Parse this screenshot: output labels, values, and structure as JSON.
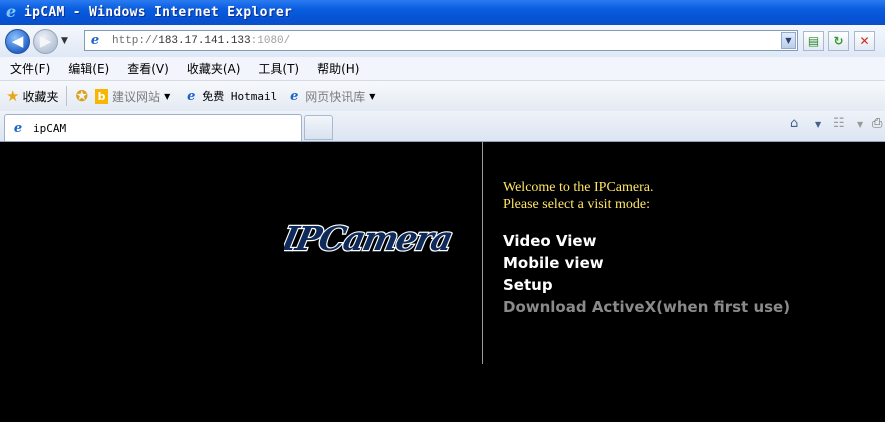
{
  "window": {
    "title": "ipCAM - Windows Internet Explorer"
  },
  "address": {
    "prefix": "http://",
    "host": "183.17.141.133",
    "port": ":1080/"
  },
  "menu": [
    "文件(F)",
    "编辑(E)",
    "查看(V)",
    "收藏夹(A)",
    "工具(T)",
    "帮助(H)"
  ],
  "favorites": {
    "label": "收藏夹",
    "items": [
      "建议网站",
      "免费 Hotmail",
      "网页快讯库"
    ]
  },
  "tab": {
    "label": "ipCAM"
  },
  "page": {
    "logo_text": "IPCamera",
    "welcome_line1": "Welcome to the IPCamera.",
    "welcome_line2": "Please select a visit mode:",
    "modes": [
      "Video View",
      "Mobile view",
      "Setup",
      "Download ActiveX(when first use)"
    ]
  },
  "colors": {
    "welcome": "#ffe566",
    "mode_link": "#ffffff",
    "mode_disabled": "#8a8a8a",
    "logo": "#3f6fb0"
  },
  "icons": [
    "ie-icon",
    "back-arrow-icon",
    "forward-arrow-icon",
    "refresh-icon",
    "stop-icon",
    "star-icon",
    "add-favorite-icon",
    "bing-icon",
    "home-icon",
    "feeds-icon",
    "print-icon"
  ]
}
